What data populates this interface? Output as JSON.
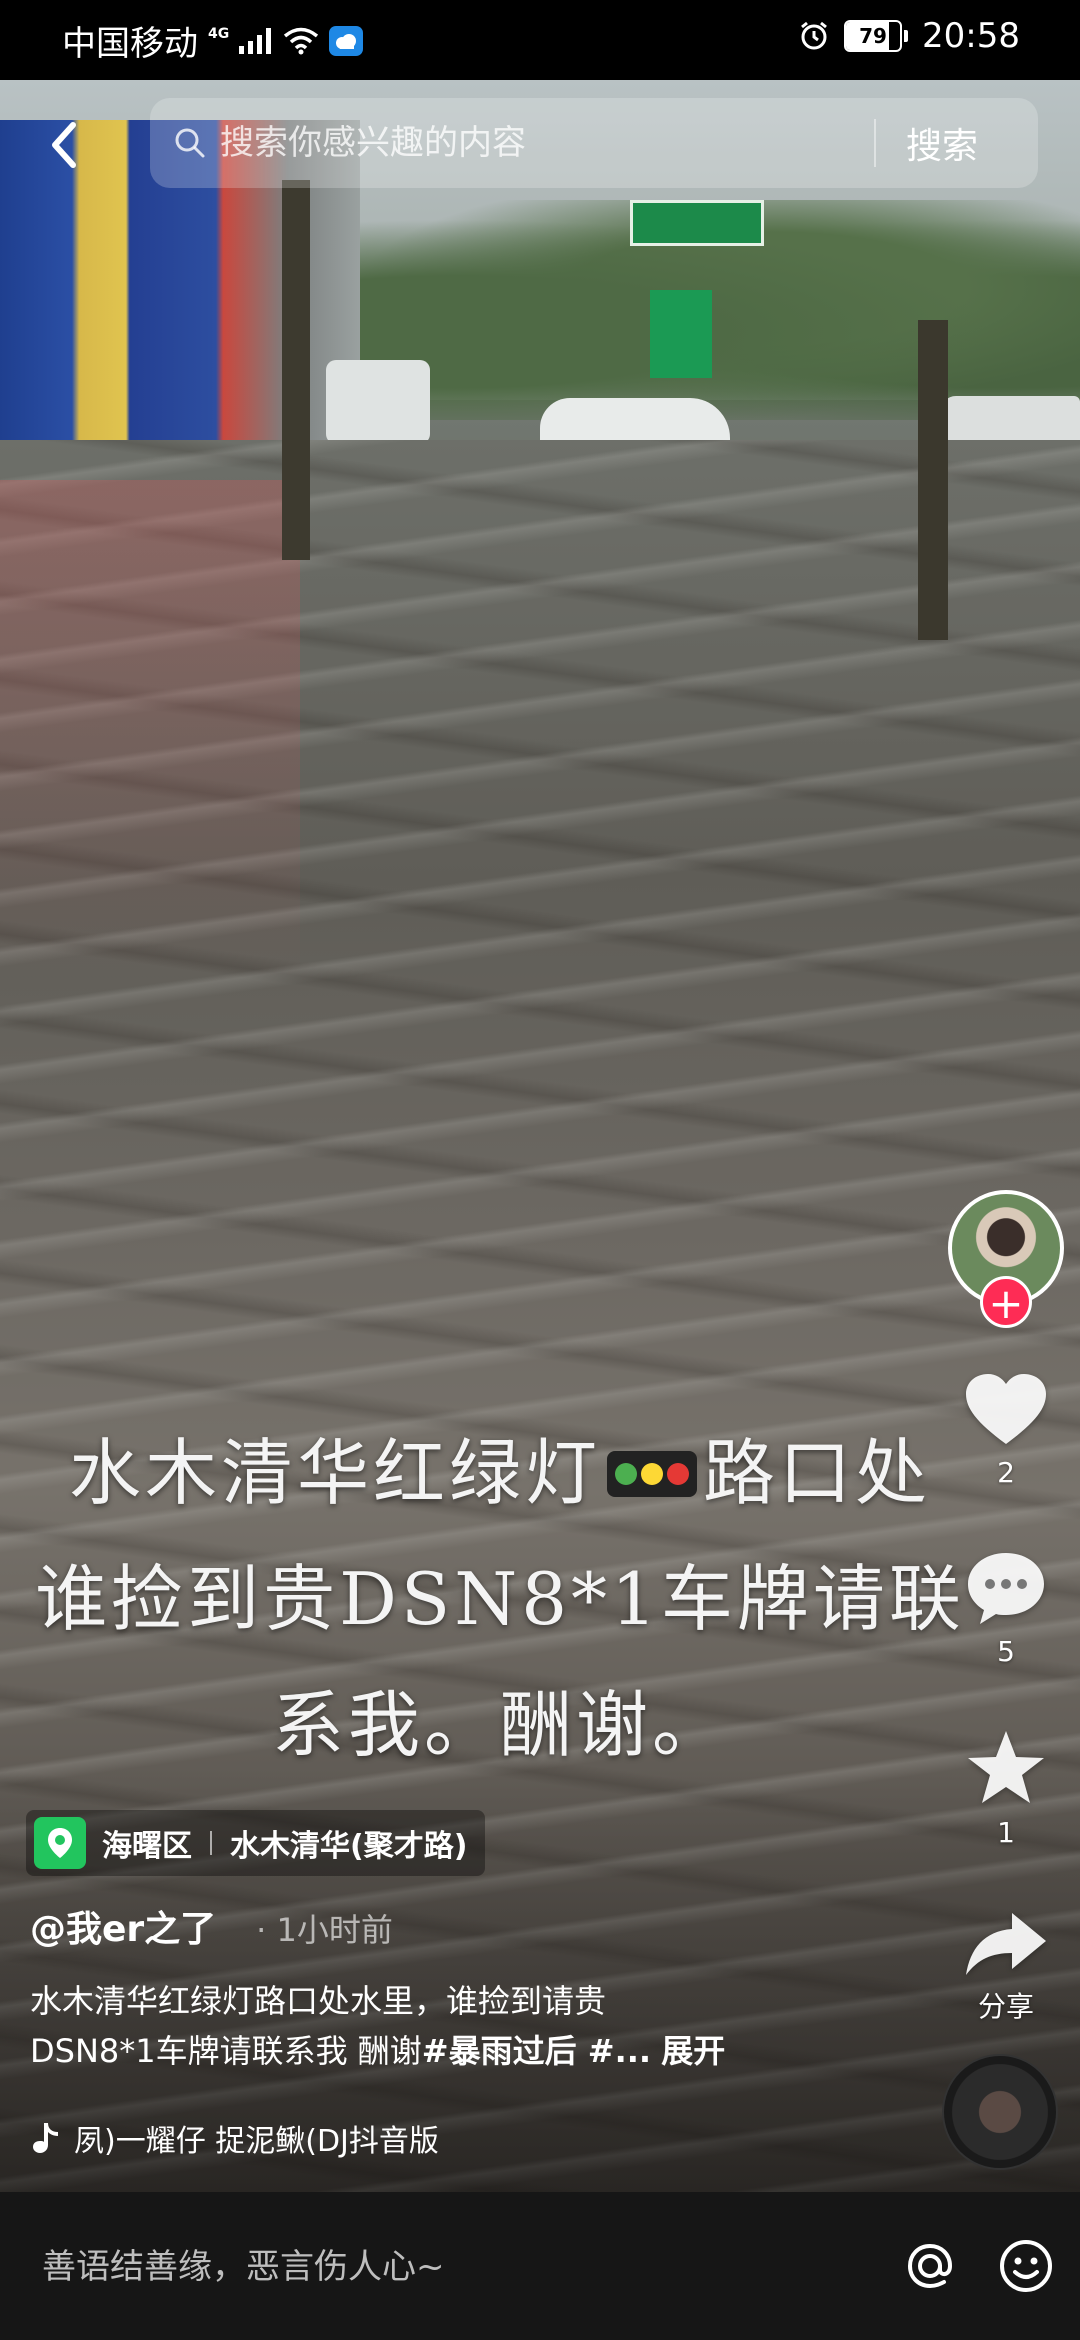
{
  "status_bar": {
    "carrier": "中国移动",
    "network": "4G",
    "battery": "79",
    "time": "20:58"
  },
  "search": {
    "placeholder": "搜索你感兴趣的内容",
    "button_label": "搜索"
  },
  "caption": {
    "line1_a": "水木清华红绿灯",
    "line1_b": "路口处",
    "line2": "谁捡到贵DSN8*1车牌请联",
    "line3": "系我。酬谢。"
  },
  "actions": {
    "like_count": "2",
    "comment_count": "5",
    "favorite_count": "1",
    "share_label": "分享"
  },
  "location": {
    "district": "海曙区",
    "place": "水木清华(聚才路)"
  },
  "post": {
    "author": "@我er之了",
    "time_ago": "· 1小时前",
    "desc_line1": "水木清华红绿灯路口处水里，谁捡到请贵",
    "desc_line2_plain": "DSN8*1车牌请联系我 酬谢",
    "desc_line2_tags": "#暴雨过后 #...",
    "expand_label": "展开"
  },
  "music": {
    "text": "夙)一耀仔    捉泥鳅(DJ抖音版"
  },
  "comment_bar": {
    "placeholder": "善语结善缘，恶言伤人心~"
  },
  "colors": {
    "follow_red": "#fe2c55",
    "location_green": "#22c55e"
  }
}
